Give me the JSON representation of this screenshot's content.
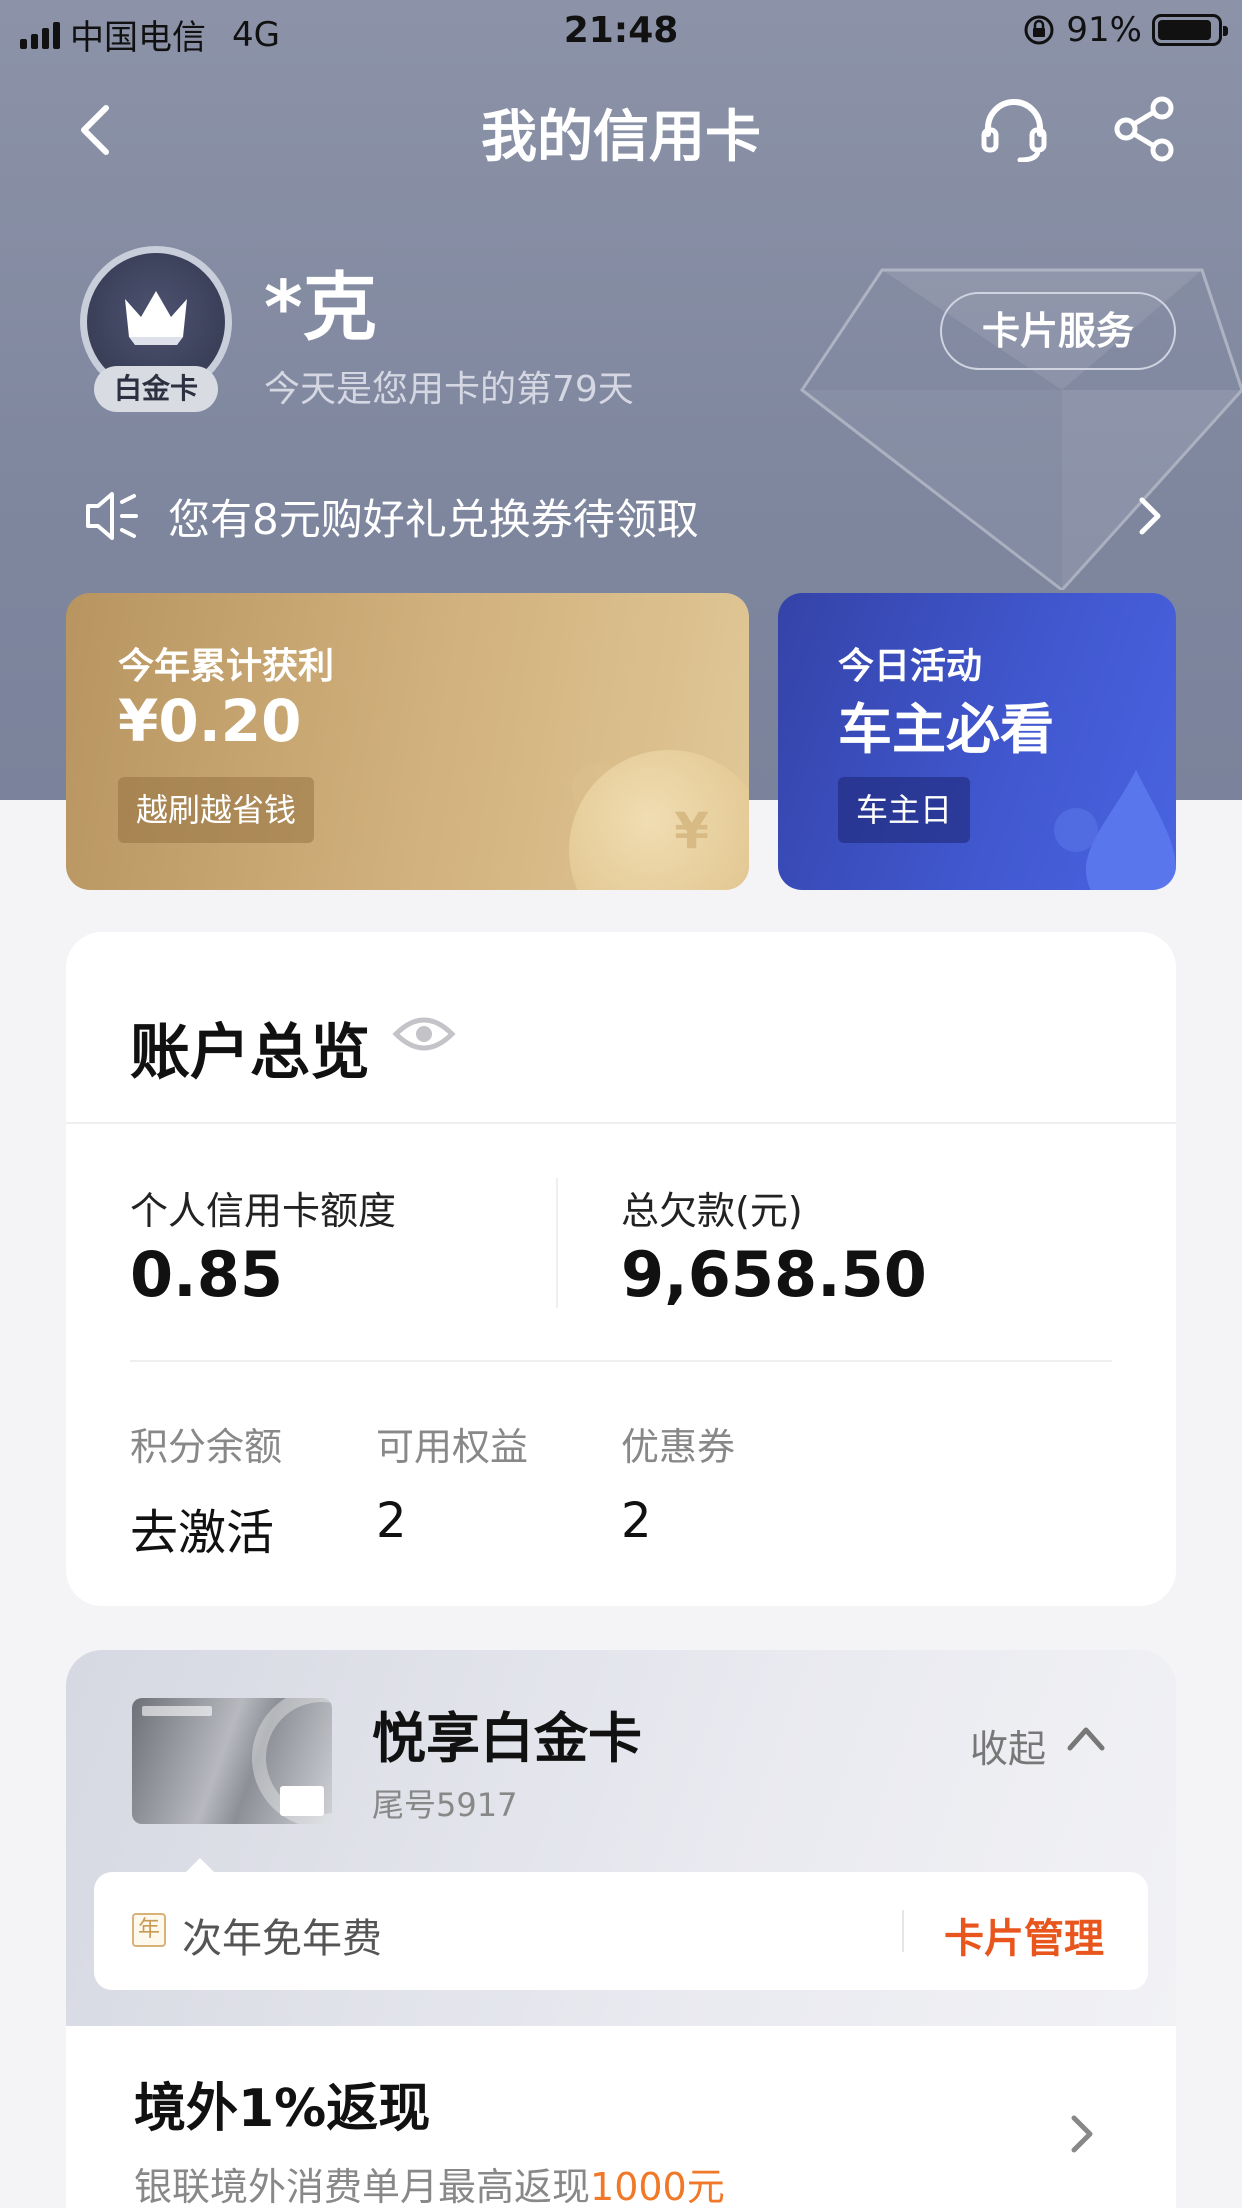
{
  "status_bar": {
    "carrier": "中国电信",
    "network": "4G",
    "time": "21:48",
    "battery": "91%",
    "battery_level": 0.91
  },
  "nav": {
    "title": "我的信用卡"
  },
  "profile": {
    "tier": "白金卡",
    "name": "*克",
    "days_text": "今天是您用卡的第79天",
    "card_service": "卡片服务"
  },
  "notice": {
    "text": "您有8元购好礼兑换券待领取"
  },
  "profit_card": {
    "label": "今年累计获利",
    "value": "¥0.20",
    "tag": "越刷越省钱",
    "coin_symbol": "¥"
  },
  "activity_card": {
    "label": "今日活动",
    "title": "车主必看",
    "tag": "车主日"
  },
  "overview": {
    "title": "账户总览",
    "limit_label": "个人信用卡额度",
    "limit_value": "0.85",
    "debt_label": "总欠款(元)",
    "debt_value": "9,658.50",
    "stats": [
      {
        "label": "积分余额",
        "value": "去激活"
      },
      {
        "label": "可用权益",
        "value": "2"
      },
      {
        "label": "优惠券",
        "value": "2"
      }
    ]
  },
  "card": {
    "name": "悦享白金卡",
    "tail": "尾号5917",
    "collapse": "收起",
    "fee_badge": "年",
    "fee_text": "次年免年费",
    "manage": "卡片管理"
  },
  "promo": {
    "title": "境外1%返现",
    "subtitle_prefix": "银联境外消费单月最高返现",
    "subtitle_highlight": "1000元"
  },
  "colors": {
    "accent_orange": "#e8561e",
    "highlight": "#f07828",
    "hero_bg": "#8c93a8",
    "gold": "#c9a66e",
    "blue": "#3f55cc"
  }
}
